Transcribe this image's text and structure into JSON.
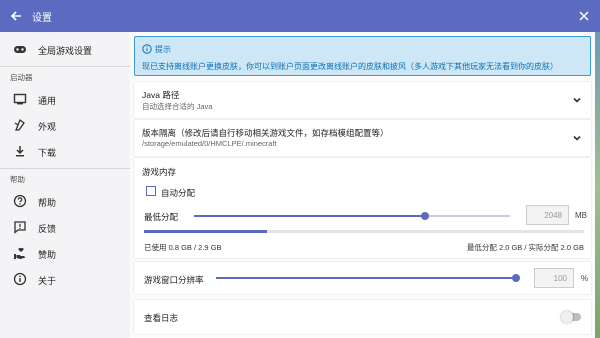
{
  "header": {
    "title": "设置"
  },
  "sidebar": {
    "global_settings": "全局游戏设置",
    "section_launcher": "启动器",
    "general": "通用",
    "appearance": "外观",
    "download": "下载",
    "section_help": "帮助",
    "help": "帮助",
    "feedback": "反馈",
    "sponsor": "赞助",
    "about": "关于"
  },
  "hint": {
    "title": "提示",
    "body": "现已支持离线账户更换皮肤，你可以到账户页面更改离线账户的皮肤和披风（多人游戏下其他玩家无法看到你的皮肤）"
  },
  "java": {
    "title": "Java 路径",
    "subtitle": "自动选择合适的 Java"
  },
  "isolation": {
    "title": "版本隔离（修改后请自行移动相关游戏文件，如存档模组配置等）",
    "subtitle": "/storage/emulated/0/HMCLPE/.minecraft"
  },
  "memory": {
    "section_title": "游戏内存",
    "auto_label": "自动分配",
    "min_label": "最低分配",
    "value": "2048",
    "unit": "MB",
    "slider_fraction": 0.73,
    "used_text": "已使用 0.8 GB / 2.9 GB",
    "used_fraction": 0.28,
    "alloc_text": "最低分配 2.0 GB / 实际分配 2.0 GB"
  },
  "resolution": {
    "label": "游戏窗口分辨率",
    "value": "100",
    "unit": "%",
    "slider_fraction": 1.0
  },
  "log": {
    "label": "查看日志"
  },
  "colors": {
    "accent": "#5c6bc0",
    "hint_bg": "#cde7f6",
    "hint_text": "#0b6fb5"
  }
}
